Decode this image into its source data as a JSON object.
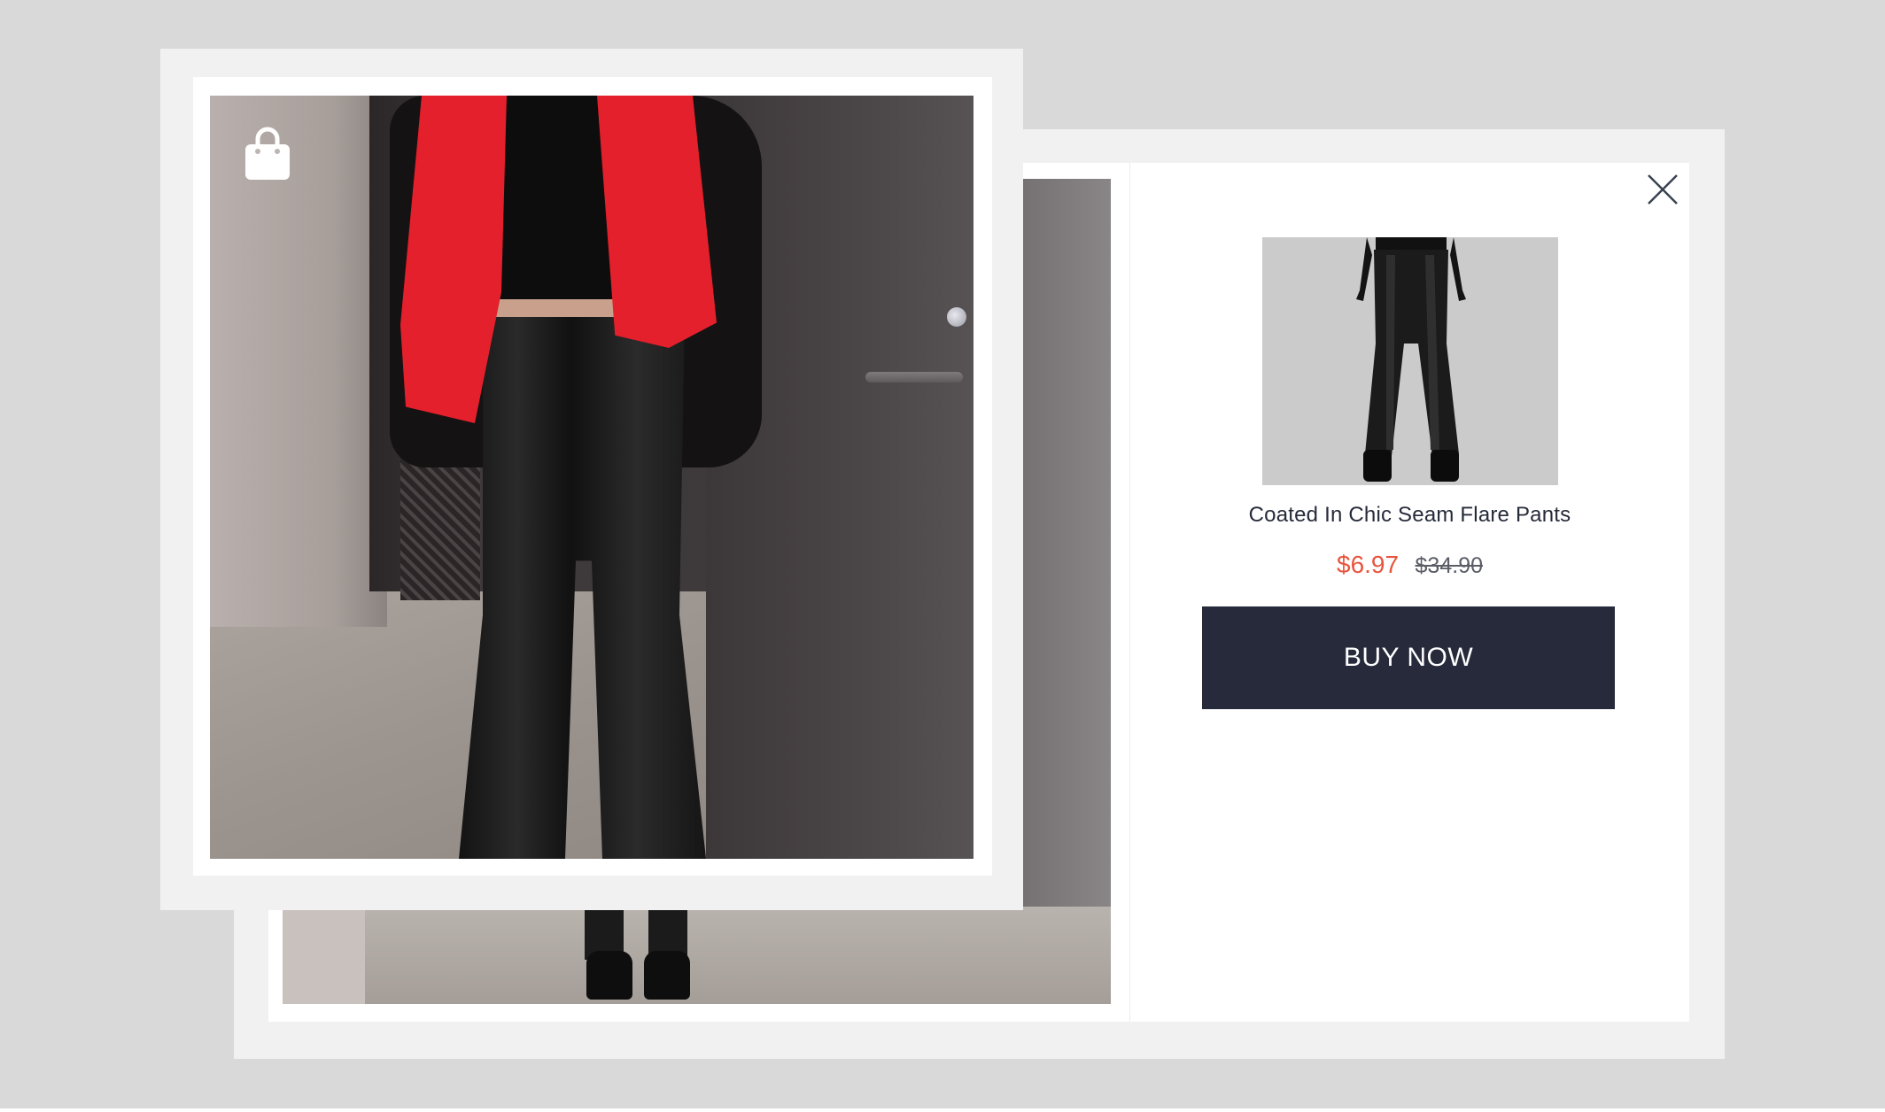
{
  "product": {
    "name": "Coated In Chic Seam Flare Pants",
    "sale_price": "$6.97",
    "original_price": "$34.90",
    "buy_label": "BUY NOW"
  },
  "icons": {
    "close": "close-icon",
    "bag": "shopping-bag-icon"
  },
  "colors": {
    "sale_price": "#e8543d",
    "buy_button": "#262a3a",
    "scarf": "#e3202b"
  }
}
